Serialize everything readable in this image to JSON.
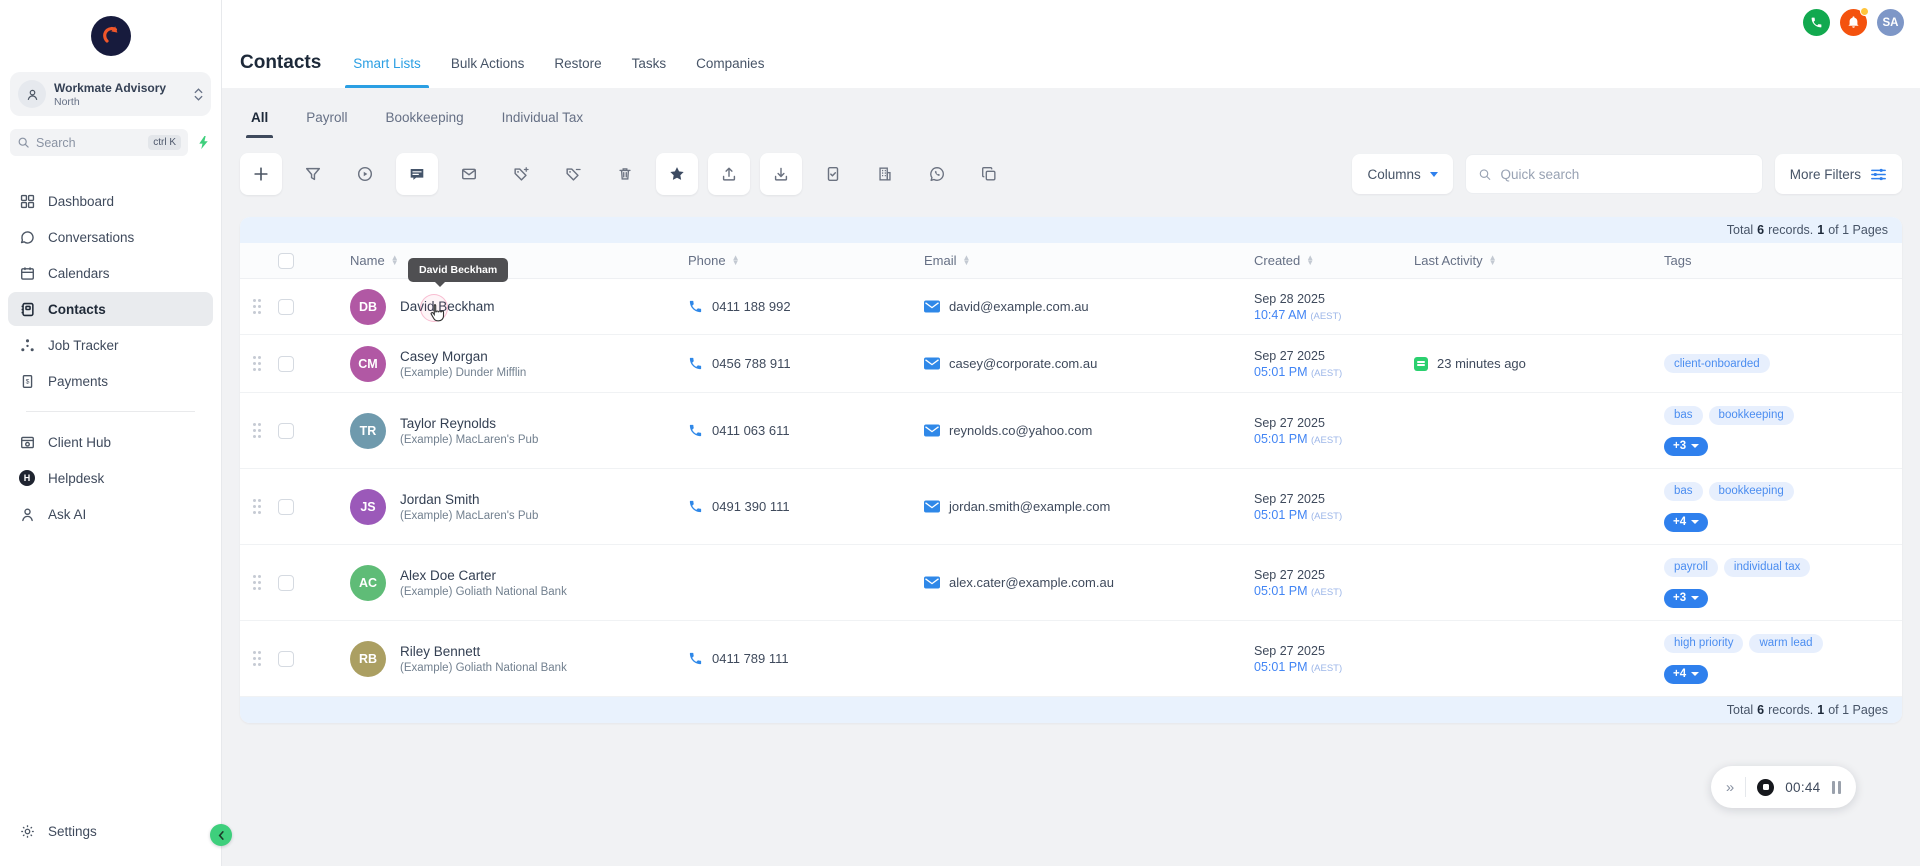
{
  "colors": {
    "accent_blue": "#2b9fe3",
    "link_blue": "#4285f4",
    "tag_bg": "#e7effd",
    "tag_text": "#4b8df0",
    "tag_solid": "#2f80ed",
    "activity_green": "#2bd06f",
    "call_green": "#12a94f",
    "alert_orange": "#f4520e",
    "logo_navy": "#171b3d",
    "logo_orange": "#f0562a"
  },
  "sidebar": {
    "agency": {
      "name": "Workmate Advisory",
      "location": "North"
    },
    "search": {
      "placeholder": "Search",
      "shortcut": "ctrl K"
    },
    "items": [
      {
        "label": "Dashboard"
      },
      {
        "label": "Conversations"
      },
      {
        "label": "Calendars"
      },
      {
        "label": "Contacts"
      },
      {
        "label": "Job Tracker"
      },
      {
        "label": "Payments"
      }
    ],
    "secondary_items": [
      {
        "label": "Client Hub"
      },
      {
        "label": "Helpdesk"
      },
      {
        "label": "Ask AI"
      }
    ],
    "settings_label": "Settings"
  },
  "topbar": {
    "title": "Contacts",
    "tabs": [
      {
        "label": "Smart Lists"
      },
      {
        "label": "Bulk Actions"
      },
      {
        "label": "Restore"
      },
      {
        "label": "Tasks"
      },
      {
        "label": "Companies"
      }
    ],
    "avatar_initials": "SA"
  },
  "subtabs": [
    {
      "label": "All"
    },
    {
      "label": "Payroll"
    },
    {
      "label": "Bookkeeping"
    },
    {
      "label": "Individual Tax"
    }
  ],
  "toolbar": {
    "columns_label": "Columns",
    "quick_search_placeholder": "Quick search",
    "more_filters_label": "More Filters"
  },
  "table": {
    "summary": {
      "pre": "Total",
      "count": "6",
      "mid": "records.",
      "page": "1",
      "post": "of 1 Pages"
    },
    "columns": [
      "Name",
      "Phone",
      "Email",
      "Created",
      "Last Activity",
      "Tags"
    ],
    "rows": [
      {
        "initials": "DB",
        "avatar_color": "#b158a4",
        "name": "David Beckham",
        "company": "",
        "phone": "0411 188 992",
        "email": "david@example.com.au",
        "created_date": "Sep 28 2025",
        "created_time": "10:47 AM",
        "created_tz": "(AEST)",
        "last_activity": "",
        "tags": [],
        "more_tag": "",
        "tooltip": "David Beckham"
      },
      {
        "initials": "CM",
        "avatar_color": "#b158a4",
        "name": "Casey Morgan",
        "company": "(Example) Dunder Mifflin",
        "phone": "0456 788 911",
        "email": "casey@corporate.com.au",
        "created_date": "Sep 27 2025",
        "created_time": "05:01 PM",
        "created_tz": "(AEST)",
        "last_activity": "23 minutes ago",
        "tags": [
          "client-onboarded"
        ],
        "more_tag": ""
      },
      {
        "initials": "TR",
        "avatar_color": "#6f9aad",
        "name": "Taylor Reynolds",
        "company": "(Example) MacLaren's Pub",
        "phone": "0411 063 611",
        "email": "reynolds.co@yahoo.com",
        "created_date": "Sep 27 2025",
        "created_time": "05:01 PM",
        "created_tz": "(AEST)",
        "last_activity": "",
        "tags": [
          "bas",
          "bookkeeping"
        ],
        "more_tag": "+3"
      },
      {
        "initials": "JS",
        "avatar_color": "#9b59b9",
        "name": "Jordan Smith",
        "company": "(Example) MacLaren's Pub",
        "phone": "0491 390 111",
        "email": "jordan.smith@example.com",
        "created_date": "Sep 27 2025",
        "created_time": "05:01 PM",
        "created_tz": "(AEST)",
        "last_activity": "",
        "tags": [
          "bas",
          "bookkeeping"
        ],
        "more_tag": "+4"
      },
      {
        "initials": "AC",
        "avatar_color": "#5fbc77",
        "name": "Alex Doe Carter",
        "company": "(Example) Goliath National Bank",
        "phone": "",
        "email": "alex.cater@example.com.au",
        "created_date": "Sep 27 2025",
        "created_time": "05:01 PM",
        "created_tz": "(AEST)",
        "last_activity": "",
        "tags": [
          "payroll",
          "individual tax"
        ],
        "more_tag": "+3"
      },
      {
        "initials": "RB",
        "avatar_color": "#ab9f62",
        "name": "Riley Bennett",
        "company": "(Example) Goliath National Bank",
        "phone": "0411 789 111",
        "email": "",
        "created_date": "Sep 27 2025",
        "created_time": "05:01 PM",
        "created_tz": "(AEST)",
        "last_activity": "",
        "tags": [
          "high priority",
          "warm lead"
        ],
        "more_tag": "+4"
      }
    ]
  },
  "timer": {
    "time": "00:44",
    "expand_glyph": "»"
  }
}
